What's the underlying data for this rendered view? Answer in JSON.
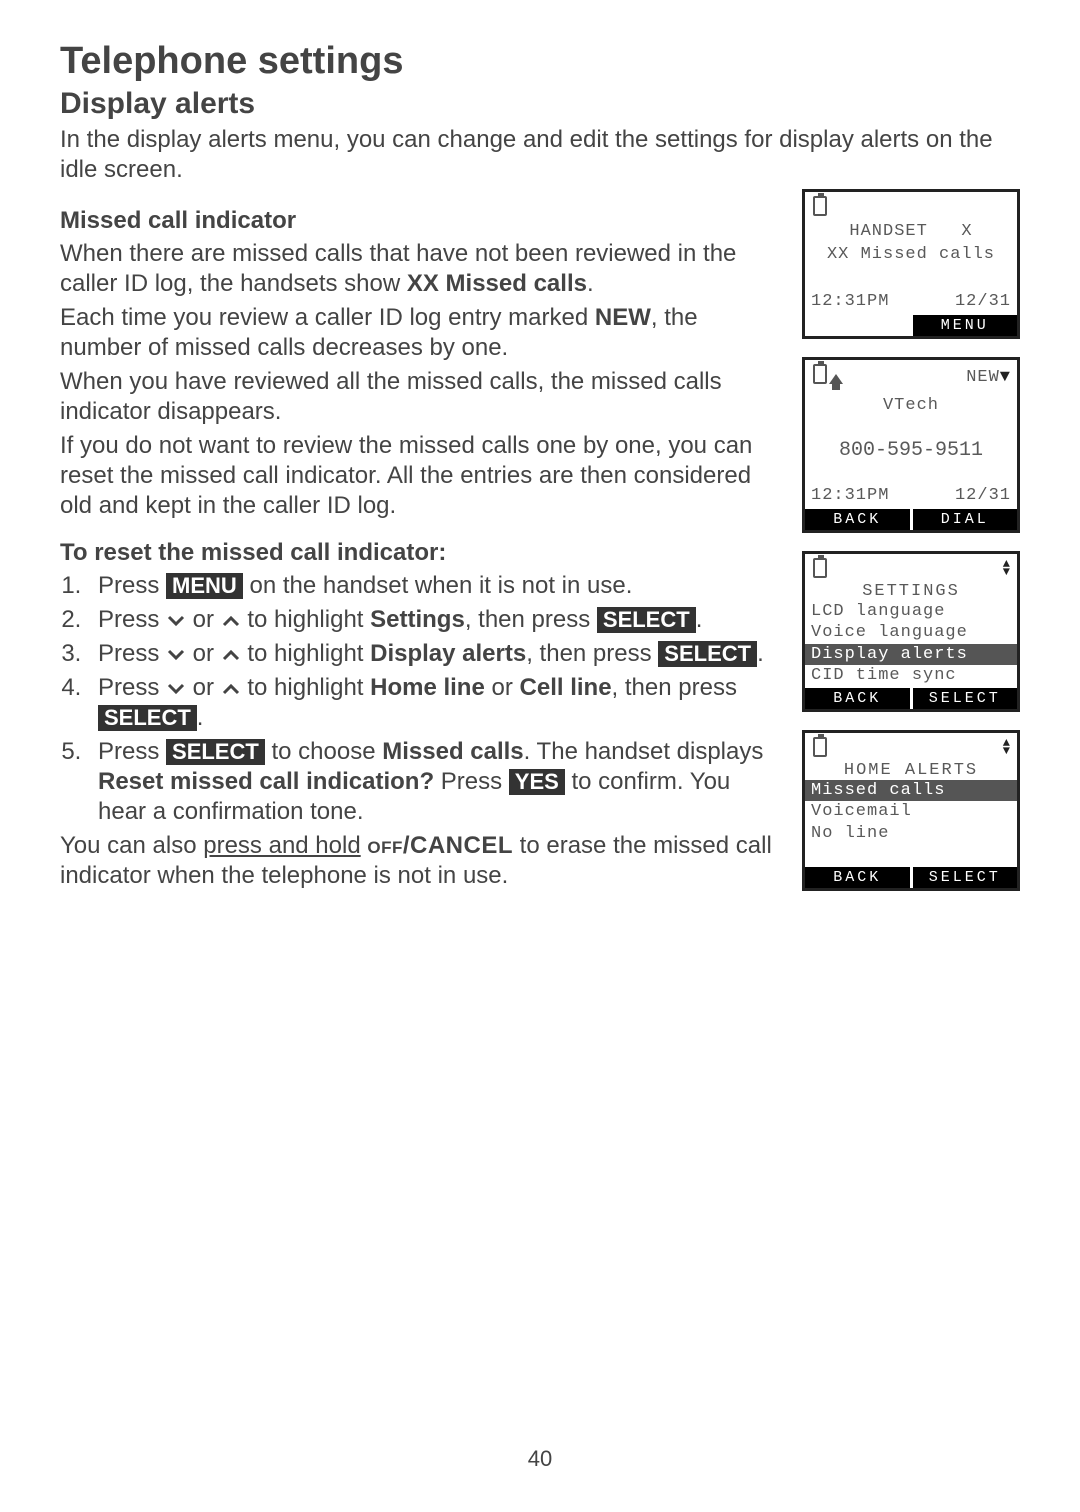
{
  "h1": "Telephone settings",
  "h2": "Display alerts",
  "intro": "In the display alerts menu, you can change and edit the settings for display alerts on the idle screen.",
  "h3a": "Missed call indicator",
  "p1a": "When there are missed calls that have not been reviewed in the caller ID log, the handsets show ",
  "p1b": "XX Missed calls",
  "p1c": ".",
  "p2a": "Each time you review a caller ID log entry marked ",
  "p2b": "NEW",
  "p2c": ", the number of missed calls decreases by one.",
  "p3": "When you have reviewed all the missed calls, the missed calls indicator disappears.",
  "p4": "If you do not want to review the missed calls one by one, you can reset the missed call indicator. All the entries are then considered old and kept in the caller ID log.",
  "h3b": "To reset the missed call indicator:",
  "step1a": "Press ",
  "menu": "MENU",
  "step1b": " on the handset when it is not in use.",
  "step2a": "Press ",
  "or": " or ",
  "step2b": " to highlight ",
  "settings": "Settings",
  "step2c": ", then press ",
  "select": "SELECT",
  "period": ".",
  "step3b": "Display alerts",
  "step4b": "Home line",
  "step4c": "Cell line",
  "step4or": " or ",
  "step4d": ", then press ",
  "step5a": "Press ",
  "step5b": " to choose ",
  "step5c": "Missed calls",
  "step5d": ". The handset displays ",
  "step5e": "Reset missed call indication?",
  "step5f": " Press ",
  "yes": "YES",
  "step5g": " to confirm. You hear a confirmation tone.",
  "note_a": "You can also ",
  "note_b": "press and hold",
  "note_c": " ",
  "offcancel": "off/CANCEL",
  "note_d": " to erase the missed call indicator when the telephone is not in use.",
  "pagenum": "40",
  "lcd1": {
    "title": "HANDSET   X",
    "line2": "XX Missed calls",
    "time": "12:31PM",
    "date": "12/31",
    "sk_right": "MENU"
  },
  "lcd2": {
    "newlabel": "NEW",
    "name": "VTech",
    "number": "800-595-9511",
    "time": "12:31PM",
    "date": "12/31",
    "sk_left": "BACK",
    "sk_right": "DIAL"
  },
  "lcd3": {
    "title": "SETTINGS",
    "items": [
      "LCD language",
      "Voice language",
      "Display alerts",
      "CID time sync"
    ],
    "hl_index": 2,
    "sk_left": "BACK",
    "sk_right": "SELECT"
  },
  "lcd4": {
    "title": "HOME ALERTS",
    "items": [
      "Missed calls",
      "Voicemail",
      "No line"
    ],
    "hl_index": 0,
    "sk_left": "BACK",
    "sk_right": "SELECT"
  }
}
